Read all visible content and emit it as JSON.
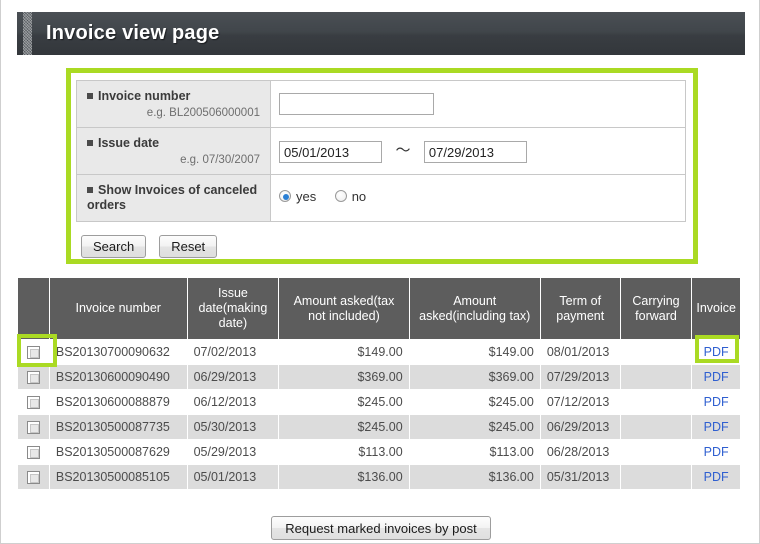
{
  "header": {
    "title": "Invoice view page"
  },
  "search": {
    "invoice_number": {
      "label": "Invoice number",
      "hint": "e.g. BL200506000001",
      "value": "",
      "placeholder": ""
    },
    "issue_date": {
      "label": "Issue date",
      "hint": "e.g. 07/30/2007",
      "from_value": "05/01/2013",
      "to_value": "07/29/2013",
      "separator": "〜"
    },
    "canceled_orders": {
      "label": "Show Invoices of canceled orders",
      "options": [
        {
          "label": "yes",
          "checked": true
        },
        {
          "label": "no",
          "checked": false
        }
      ]
    },
    "buttons": {
      "search": "Search",
      "reset": "Reset"
    }
  },
  "results": {
    "columns": [
      "",
      "Invoice number",
      "Issue date(making date)",
      "Amount asked(tax not included)",
      "Amount asked(including tax)",
      "Term of payment",
      "Carrying forward",
      "Invoice"
    ],
    "rows": [
      {
        "invoice_number": "BS20130700090632",
        "issue_date": "07/02/2013",
        "amount_excl_tax": "$149.00",
        "amount_incl_tax": "$149.00",
        "term_of_payment": "08/01/2013",
        "carrying_forward": "",
        "invoice_link": "PDF",
        "checked": false
      },
      {
        "invoice_number": "BS20130600090490",
        "issue_date": "06/29/2013",
        "amount_excl_tax": "$369.00",
        "amount_incl_tax": "$369.00",
        "term_of_payment": "07/29/2013",
        "carrying_forward": "",
        "invoice_link": "PDF",
        "checked": false
      },
      {
        "invoice_number": "BS20130600088879",
        "issue_date": "06/12/2013",
        "amount_excl_tax": "$245.00",
        "amount_incl_tax": "$245.00",
        "term_of_payment": "07/12/2013",
        "carrying_forward": "",
        "invoice_link": "PDF",
        "checked": false
      },
      {
        "invoice_number": "BS20130500087735",
        "issue_date": "05/30/2013",
        "amount_excl_tax": "$245.00",
        "amount_incl_tax": "$245.00",
        "term_of_payment": "06/29/2013",
        "carrying_forward": "",
        "invoice_link": "PDF",
        "checked": false
      },
      {
        "invoice_number": "BS20130500087629",
        "issue_date": "05/29/2013",
        "amount_excl_tax": "$113.00",
        "amount_incl_tax": "$113.00",
        "term_of_payment": "06/28/2013",
        "carrying_forward": "",
        "invoice_link": "PDF",
        "checked": false
      },
      {
        "invoice_number": "BS20130500085105",
        "issue_date": "05/01/2013",
        "amount_excl_tax": "$136.00",
        "amount_incl_tax": "$136.00",
        "term_of_payment": "05/31/2013",
        "carrying_forward": "",
        "invoice_link": "PDF",
        "checked": false
      }
    ]
  },
  "footer": {
    "request_button": "Request marked invoices by post"
  },
  "colors": {
    "highlight": "#aada23",
    "header_bar": "#3d4247",
    "table_header": "#5d5d5d",
    "row_alt": "#dcdcdc",
    "link": "#2f5fd0",
    "radio_selected": "#2a7fd4"
  }
}
